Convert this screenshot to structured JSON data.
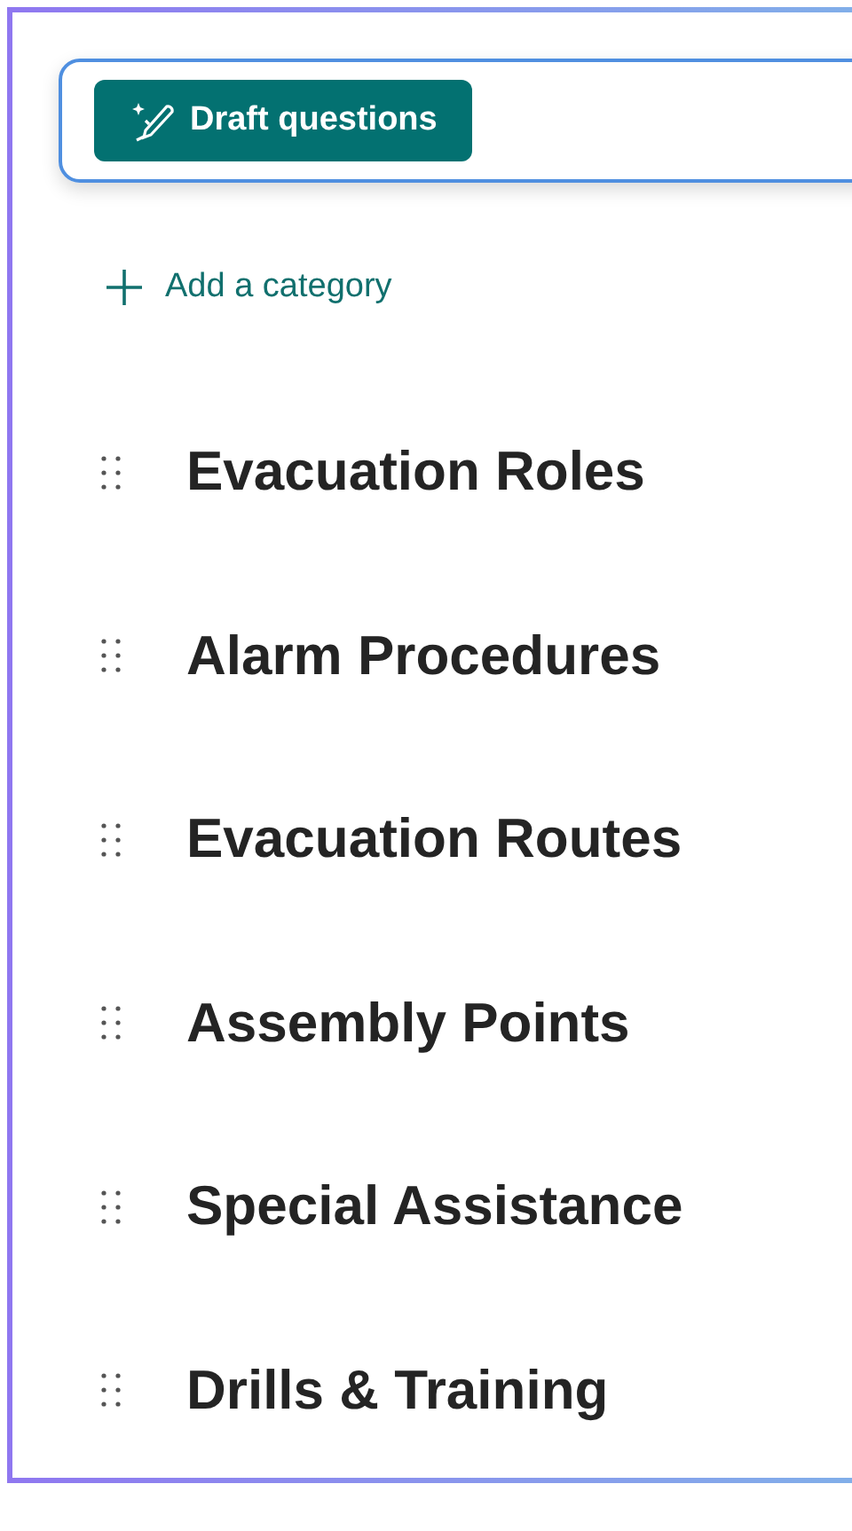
{
  "draft_button": {
    "label": "Draft questions"
  },
  "add_category": {
    "label": "Add a category"
  },
  "categories": [
    {
      "title": "Evacuation Roles"
    },
    {
      "title": "Alarm Procedures"
    },
    {
      "title": "Evacuation Routes"
    },
    {
      "title": "Assembly Points"
    },
    {
      "title": "Special Assistance"
    },
    {
      "title": "Drills & Training"
    }
  ]
}
